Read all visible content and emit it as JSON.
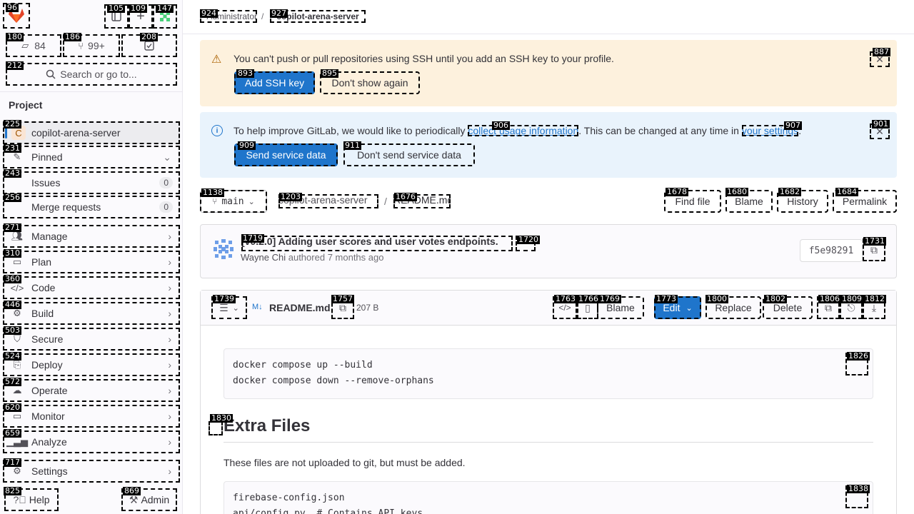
{
  "badges": {
    "logo": "96",
    "panel": "105",
    "new": "109",
    "avatar": "147",
    "issues_count_btn": "180",
    "mr_count_btn": "186",
    "todo_btn": "208",
    "search": "212",
    "nav_project": "225",
    "nav_pinned": "231",
    "nav_issues": "243",
    "nav_mr": "256",
    "nav_manage": "271",
    "nav_plan": "310",
    "nav_code": "360",
    "nav_build": "446",
    "nav_secure": "503",
    "nav_deploy": "524",
    "nav_operate": "572",
    "nav_monitor": "620",
    "nav_analyze": "659",
    "nav_settings": "717",
    "help": "825",
    "admin": "869",
    "crumb1": "924",
    "crumb2": "927",
    "ssh_close": "887",
    "add_ssh": "893",
    "dont_show": "895",
    "collect_link": "906",
    "settings_link": "907",
    "info_close": "901",
    "send_data": "909",
    "dont_send": "911",
    "branch": "1138",
    "path_project": "1203",
    "path_file": "1676",
    "find_file": "1678",
    "blame": "1680",
    "history": "1682",
    "permalink": "1684",
    "commit_title": "1719",
    "commit_toggle": "1720",
    "copy_sha": "1731",
    "toc": "1739",
    "copy_path": "1757",
    "code_view": "1763",
    "raw_view": "1766",
    "blame2": "1769",
    "edit": "1773",
    "replace": "1800",
    "delete": "1802",
    "copy_contents": "1806",
    "open_raw": "1809",
    "download": "1812",
    "copy_code1": "1826",
    "heading_anchor": "1830",
    "copy_code2": "1838"
  },
  "sidebar": {
    "issues_count": "84",
    "mr_count": "99+",
    "search_placeholder": "Search or go to...",
    "section_title": "Project",
    "project_initial": "C",
    "project_name": "copilot-arena-server",
    "items": {
      "pinned": "Pinned",
      "issues": "Issues",
      "issues_count": "0",
      "mr": "Merge requests",
      "mr_count": "0",
      "manage": "Manage",
      "plan": "Plan",
      "code": "Code",
      "build": "Build",
      "secure": "Secure",
      "deploy": "Deploy",
      "operate": "Operate",
      "monitor": "Monitor",
      "analyze": "Analyze",
      "settings": "Settings"
    },
    "help": "Help",
    "admin": "Admin"
  },
  "breadcrumb": {
    "parent": "Administrator",
    "separator": "/",
    "current": "copilot-arena-server"
  },
  "ssh_alert": {
    "message": "You can't push or pull repositories using SSH until you add an SSH key to your profile.",
    "primary": "Add SSH key",
    "secondary": "Don't show again"
  },
  "info_alert": {
    "text_before": "To help improve GitLab, we would like to periodically ",
    "link1": "collect usage information",
    "text_middle": ". This can be changed at any time in ",
    "link2": "your settings",
    "text_after": ".",
    "primary": "Send service data",
    "secondary": "Don't send service data"
  },
  "repo_nav": {
    "branch": "main",
    "project": "copilot-arena-server",
    "separator": "/",
    "file": "README.md",
    "find_file": "Find file",
    "blame": "Blame",
    "history": "History",
    "permalink": "Permalink"
  },
  "commit": {
    "title": "[v0.2.0] Adding user scores and user votes endpoints.",
    "author": "Wayne Chi",
    "authored": "authored",
    "time": "7 months ago",
    "sha": "f5e98291"
  },
  "file_header": {
    "name": "README.md",
    "size": "207 B",
    "blame": "Blame",
    "edit": "Edit",
    "replace": "Replace",
    "delete": "Delete"
  },
  "content": {
    "code1": [
      "docker compose up --build",
      "docker compose down --remove-orphans"
    ],
    "heading": "Extra Files",
    "paragraph": "These files are not uploaded to git, but must be added.",
    "code2": [
      "firebase-config.json",
      "api/config.py  # Contains API keys"
    ]
  },
  "colors": {
    "primary": "#1f75cb",
    "warning_bg": "#fdf1dd",
    "info_bg": "#e9f3fc",
    "sidebar_bg": "#fbfafd"
  }
}
